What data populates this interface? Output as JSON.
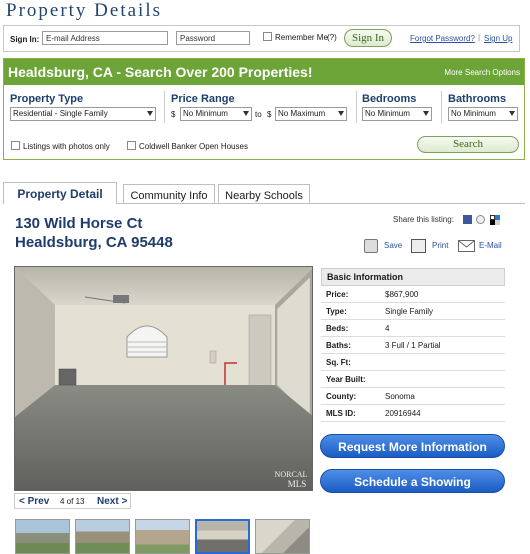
{
  "header": {
    "title": "Property Details"
  },
  "signin": {
    "label": "Sign In:",
    "email_value": "E-mail Address",
    "password_value": "Password",
    "remember": "Remember Me",
    "help": "(?)",
    "button": "Sign In",
    "forgot": "Forgot Password?",
    "separator": "|",
    "signup": "Sign Up"
  },
  "search": {
    "title": "Healdsburg, CA - Search Over 200 Properties!",
    "more": "More Search Options",
    "property_type": {
      "label": "Property Type",
      "value": "Residential - Single Family"
    },
    "price_range": {
      "label": "Price Range",
      "currency": "$",
      "min": "No Minimum",
      "to": "to",
      "currency2": "$",
      "max": "No Maximum"
    },
    "bedrooms": {
      "label": "Bedrooms",
      "value": "No Minimum"
    },
    "bathrooms": {
      "label": "Bathrooms",
      "value": "No Minimum"
    },
    "photos_only": "Listings with photos only",
    "open_houses": "Coldwell Banker Open Houses",
    "button": "Search"
  },
  "tabs": [
    {
      "label": "Property Detail"
    },
    {
      "label": "Community Info"
    },
    {
      "label": "Nearby Schools"
    }
  ],
  "listing": {
    "street": "130 Wild Horse Ct",
    "city": "Healdsburg, CA 95448",
    "share": "Share this listing:",
    "save": "Save",
    "print": "Print",
    "email": "E-Mail"
  },
  "photo": {
    "prev": "< Prev",
    "counter": "4 of 13",
    "next": "Next >",
    "watermark_top": "NORCAL",
    "watermark_bottom": "MLS"
  },
  "info": {
    "header": "Basic Information",
    "rows": [
      {
        "k": "Price:",
        "v": "$867,900"
      },
      {
        "k": "Type:",
        "v": "Single Family"
      },
      {
        "k": "Beds:",
        "v": "4"
      },
      {
        "k": "Baths:",
        "v": "3 Full / 1 Partial"
      },
      {
        "k": "Sq. Ft:",
        "v": ""
      },
      {
        "k": "Year Built:",
        "v": ""
      },
      {
        "k": "County:",
        "v": "Sonoma"
      },
      {
        "k": "MLS ID:",
        "v": "20916944"
      }
    ]
  },
  "actions": {
    "request": "Request More Information",
    "showing": "Schedule a Showing"
  },
  "colors": {
    "brand_green": "#6da438",
    "title_blue": "#24456c",
    "button_blue": "#2a6ad4"
  }
}
